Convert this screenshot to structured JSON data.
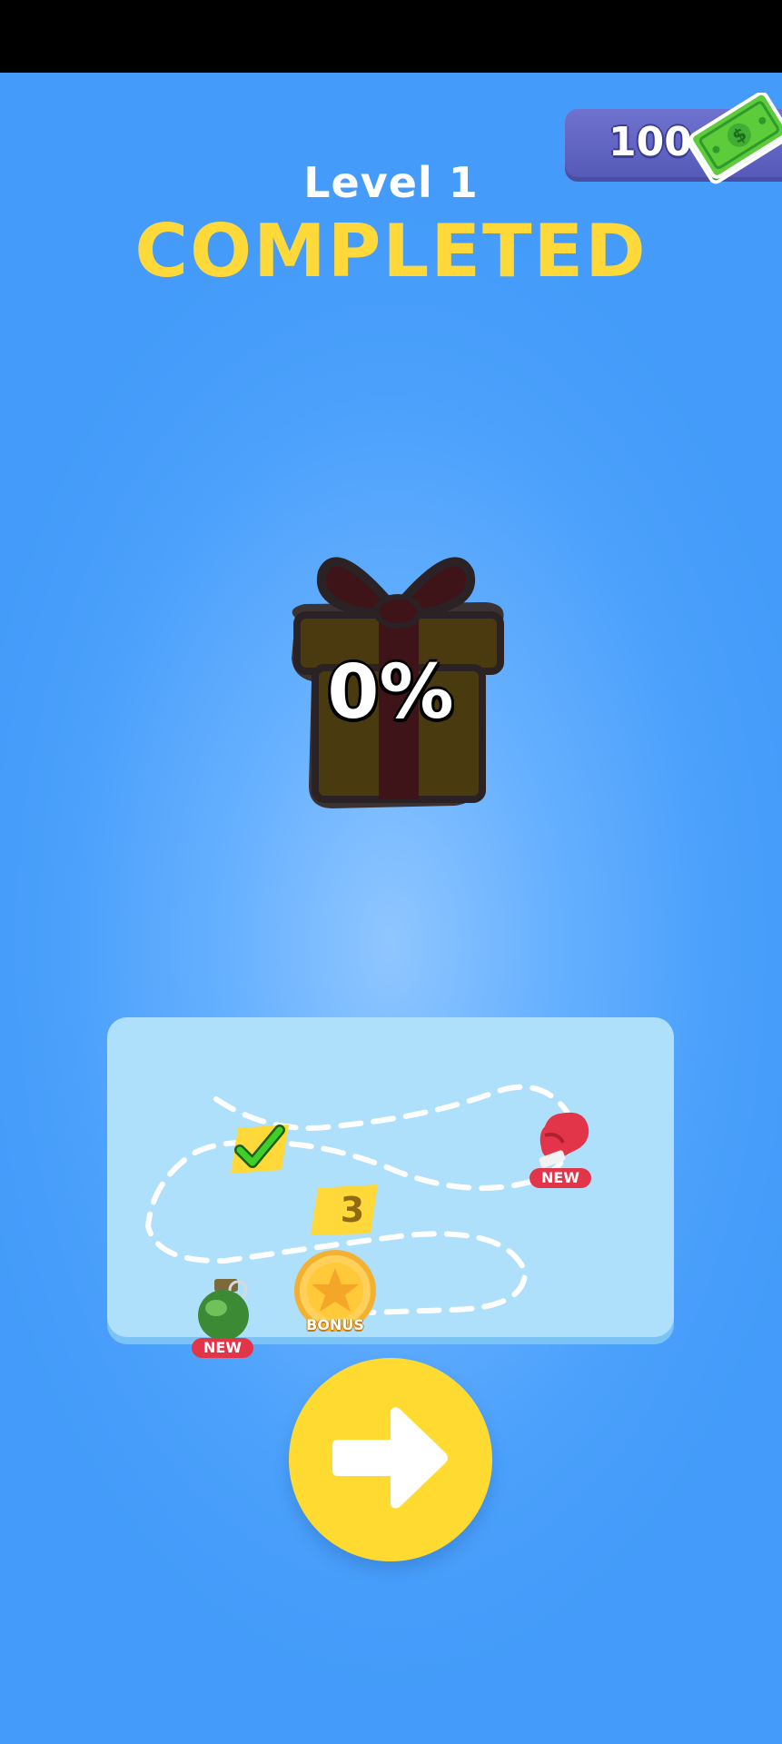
{
  "header": {
    "level_title": "Level 1",
    "completed_title": "COMPLETED"
  },
  "currency": {
    "amount": "100",
    "icon": "cash-icon"
  },
  "gift": {
    "progress_text": "0%",
    "progress_value": 0,
    "icon": "gift-box-icon"
  },
  "level_map": {
    "current_level": "3",
    "nodes": [
      {
        "type": "completed",
        "icon": "checkmark-icon"
      },
      {
        "type": "current",
        "label": "3"
      },
      {
        "type": "reward",
        "icon": "boxing-glove-icon",
        "badge": "NEW"
      },
      {
        "type": "reward",
        "icon": "grenade-icon",
        "badge": "NEW"
      },
      {
        "type": "bonus",
        "icon": "star-coin-icon",
        "badge": "BONUS"
      }
    ]
  },
  "colors": {
    "background": "#4aa0fb",
    "title_yellow": "#ffd93a",
    "currency_panel": "#5f62c2",
    "map_panel": "#aee0fb",
    "new_badge": "#e3354a",
    "next_button": "#ffdb32"
  },
  "next_button": {
    "icon": "arrow-right-icon"
  }
}
